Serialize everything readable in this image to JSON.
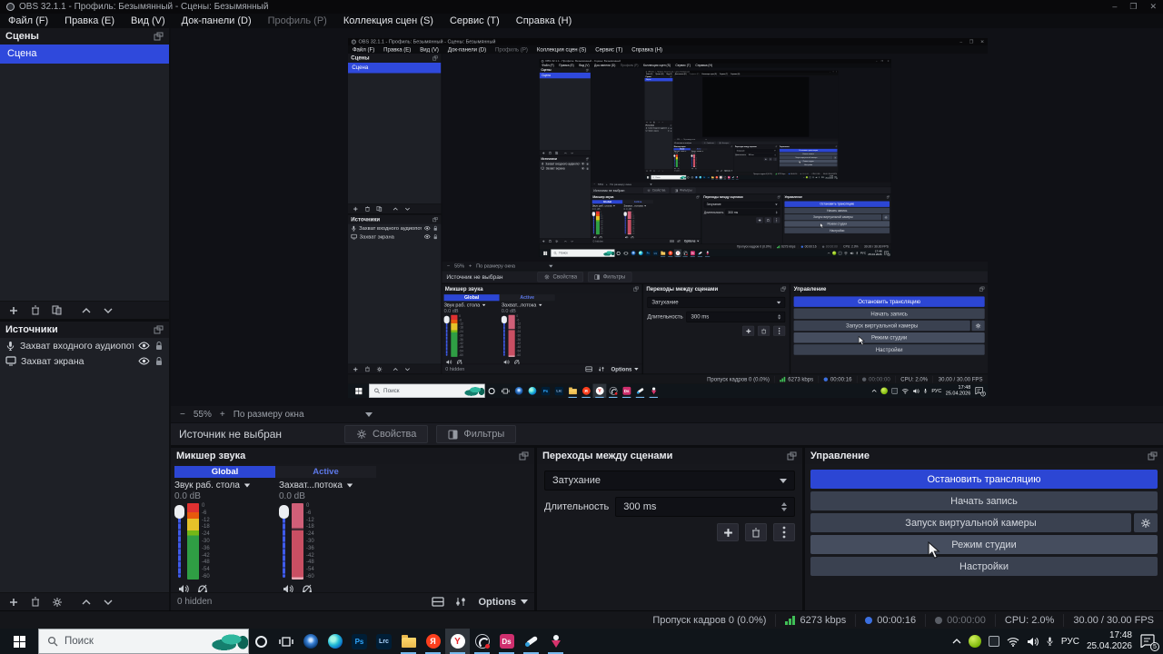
{
  "colors": {
    "accent": "#2f49dc",
    "accent_button": "#2c46d4",
    "meter_green": "#2f9e44",
    "meter_yellow": "#e6c229",
    "meter_red": "#e03131",
    "meter_idle": "#c94f63",
    "running_indicator": "#76b9ed",
    "taskbar_bg": "#10151a"
  },
  "window": {
    "title": "OBS 32.1.1 - Профиль: Безымянный - Сцены: Безымянный",
    "minimize": "–",
    "restore": "❐",
    "close": "✕"
  },
  "menu": {
    "items": [
      "Файл (F)",
      "Правка (E)",
      "Вид (V)",
      "Док-панели (D)",
      "Профиль (P)",
      "Коллекция сцен (S)",
      "Сервис (T)",
      "Справка (H)"
    ]
  },
  "scenes": {
    "title": "Сцены",
    "items": [
      "Сцена"
    ]
  },
  "sources": {
    "title": "Источники",
    "items": [
      {
        "icon": "microphone-icon",
        "label": "Захват входного аудиопотока"
      },
      {
        "icon": "display-icon",
        "label": "Захват экрана"
      }
    ]
  },
  "zoombar": {
    "zoom_out": "−",
    "zoom_level": "55%",
    "zoom_in": "+",
    "fit_mode": "По размеру окна"
  },
  "props": {
    "no_source": "Источник не выбран",
    "properties": "Свойства",
    "filters": "Фильтры"
  },
  "mixer": {
    "title": "Микшер звука",
    "tabs": {
      "global": "Global",
      "active": "Active"
    },
    "channels": [
      {
        "name": "Звук раб. стола",
        "level": "0.0 dB"
      },
      {
        "name": "Захват...потока",
        "level": "0.0 dB"
      }
    ],
    "scale": [
      "0",
      "-6",
      "-12",
      "-18",
      "-24",
      "-30",
      "-36",
      "-42",
      "-48",
      "-54",
      "-60"
    ],
    "hidden_count": "0 hidden",
    "options": "Options"
  },
  "transitions": {
    "title": "Переходы между сценами",
    "current": "Затухание",
    "duration_label": "Длительность",
    "duration_value": "300 ms"
  },
  "controls": {
    "title": "Управление",
    "stop_stream": "Остановить трансляцию",
    "start_record": "Начать запись",
    "virtual_camera": "Запуск виртуальной камеры",
    "studio_mode": "Режим студии",
    "settings": "Настройки"
  },
  "statusbar": {
    "dropped_frames": "Пропуск кадров 0 (0.0%)",
    "bitrate": "6273 kbps",
    "stream_time": "00:00:16",
    "record_time": "00:00:00",
    "cpu": "CPU: 2.0%",
    "fps": "30.00 / 30.00 FPS"
  },
  "taskbar": {
    "search_placeholder": "Поиск",
    "ps": "Ps",
    "lrc": "Lrc",
    "ya": "Я",
    "y": "Y",
    "ds": "Ds",
    "language": "РУС",
    "time": "17:48",
    "date": "25.04.2026",
    "notifications": "5"
  }
}
